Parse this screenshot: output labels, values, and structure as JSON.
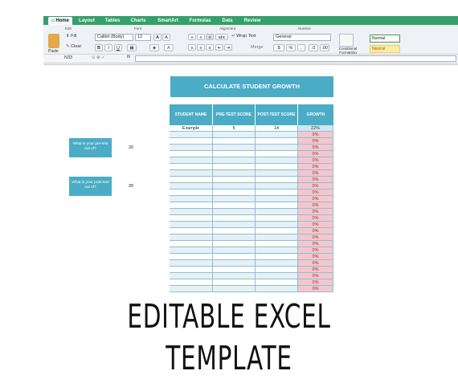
{
  "ribbon": {
    "tabs": [
      "Home",
      "Layout",
      "Tables",
      "Charts",
      "SmartArt",
      "Formulas",
      "Data",
      "Review"
    ],
    "groups": {
      "edit": "Edit",
      "font": "Font",
      "alignment": "Alignment",
      "number": "Number"
    },
    "fill_label": "Fill",
    "clear_label": "Clear",
    "paste_label": "Paste",
    "font_name": "Calibri (Body)",
    "font_size": "12",
    "wrap_text_label": "Wrap Text",
    "merge_label": "Merge",
    "number_format": "General",
    "conditional_formatting_label": "Conditional Formatting",
    "style_normal": "Normal",
    "style_neutral": "Neutral"
  },
  "formula_bar": {
    "cell_ref": "N33",
    "fx_label": "fx",
    "value": ""
  },
  "sheet": {
    "title": "CALCULATE STUDENT GROWTH",
    "columns": [
      "STUDENT NAME",
      "PRE-TEST SCORE",
      "POST-TEST SCORE",
      "GROWTH"
    ],
    "example_row": [
      "Example",
      "5",
      "14",
      "22%"
    ],
    "empty_growth": "0%",
    "empty_row_count": 25,
    "prompts": [
      {
        "label": "What is your pre-test out of?",
        "value": "20"
      },
      {
        "label": "What is your post-test out of?",
        "value": "30"
      }
    ]
  },
  "caption": "EDITABLE EXCEL TEMPLATE",
  "colors": {
    "header": "#4bacc6",
    "growth_cell": "#f4c7cf",
    "ribbon_tabs": "#36a06a"
  }
}
